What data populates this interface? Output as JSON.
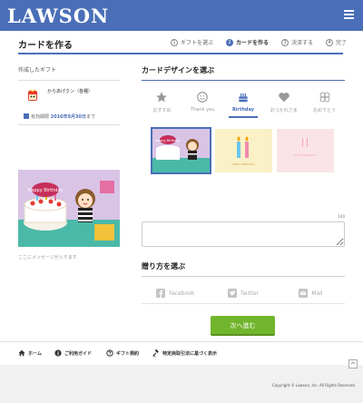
{
  "header": {
    "logo": "LAWSON"
  },
  "page": {
    "title": "カードを作る"
  },
  "steps": [
    {
      "num": "1",
      "label": "ギフトを選ぶ"
    },
    {
      "num": "2",
      "label": "カードを作る"
    },
    {
      "num": "3",
      "label": "決済する"
    },
    {
      "num": "4",
      "label": "完了"
    }
  ],
  "gift": {
    "section_label": "作成したギフト",
    "name": "からあげクン（各種）",
    "expiry_label": "有効期限",
    "expiry_date": "2016年9月30日",
    "expiry_suffix": "まで"
  },
  "preview": {
    "caption": "ここにメッセージが入ります",
    "card_text": "Happy Birthday"
  },
  "design": {
    "title": "カードデザインを選ぶ",
    "tabs": [
      {
        "label": "おすすめ",
        "icon": "star-icon"
      },
      {
        "label": "Thank you",
        "icon": "smile-icon"
      },
      {
        "label": "Birthday",
        "icon": "cake-icon"
      },
      {
        "label": "おつかれさま",
        "icon": "heart-icon"
      },
      {
        "label": "おめでとう",
        "icon": "clover-icon"
      }
    ],
    "card_texts": [
      "Happy Birthday",
      "HAPPY BIRTHDAY",
      "HAPPY BIRTHDAY"
    ]
  },
  "message": {
    "counter": "140",
    "placeholder": ""
  },
  "send": {
    "title": "贈り方を選ぶ",
    "methods": [
      {
        "label": "Facebook",
        "icon": "facebook-icon"
      },
      {
        "label": "Twitter",
        "icon": "twitter-icon"
      },
      {
        "label": "Mail",
        "icon": "mail-icon"
      }
    ]
  },
  "next_button": "次へ進む",
  "footer": {
    "links": [
      "ホーム",
      "ご利用ガイド",
      "ギフト規約",
      "特定商取引法に基づく表示"
    ],
    "copyright": "Copyright © Lawson, Inc. All Rights Reserved."
  },
  "colors": {
    "brand": "#4a6fb8",
    "action": "#71b52d"
  }
}
